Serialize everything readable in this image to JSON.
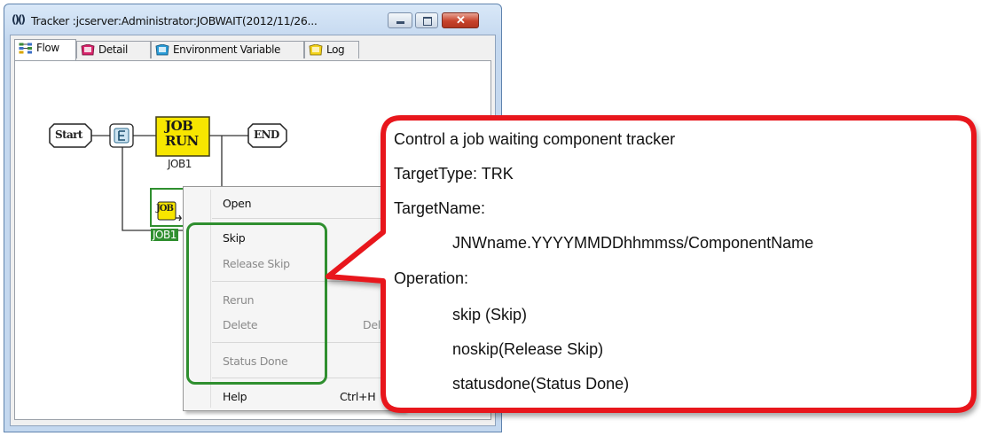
{
  "window": {
    "app_icon": "()()",
    "title": "Tracker :jcserver:Administrator:JOBWAIT(2012/11/26..."
  },
  "tabs": [
    {
      "label": "Flow",
      "icon": "flow-icon"
    },
    {
      "label": "Detail",
      "icon": "detail-icon"
    },
    {
      "label": "Environment Variable",
      "icon": "env-icon"
    },
    {
      "label": "Log",
      "icon": "log-icon"
    }
  ],
  "flow": {
    "start_label": "Start",
    "end_label": "END",
    "job_icon_line1": "JOB",
    "job_icon_line2": "RUN",
    "job1_label": "JOB1",
    "jobwait_label": "JOB1"
  },
  "context_menu": {
    "items": [
      {
        "label": "Open",
        "shortcut": "",
        "enabled": true
      },
      {
        "label": "Skip",
        "shortcut": "",
        "enabled": true
      },
      {
        "label": "Release Skip",
        "shortcut": "",
        "enabled": false
      },
      {
        "label": "Rerun",
        "shortcut": "",
        "enabled": false
      },
      {
        "label": "Delete",
        "shortcut": "Del",
        "enabled": false
      },
      {
        "label": "Status Done",
        "shortcut": "",
        "enabled": false
      },
      {
        "label": "Help",
        "shortcut": "Ctrl+H",
        "enabled": true
      }
    ]
  },
  "callout": {
    "line1": "Control a job waiting component tracker",
    "line2": "TargetType: TRK",
    "line3": "TargetName:",
    "line4": "JNWname.YYYYMMDDhhmmss/ComponentName",
    "line5": "Operation:",
    "line6": "skip (Skip)",
    "line7": "noskip(Release Skip)",
    "line8": "statusdone(Status Done)"
  },
  "colors": {
    "callout_border": "#e8161c",
    "highlight_border": "#2f8f2f",
    "job_icon_fill": "#f7e600"
  }
}
